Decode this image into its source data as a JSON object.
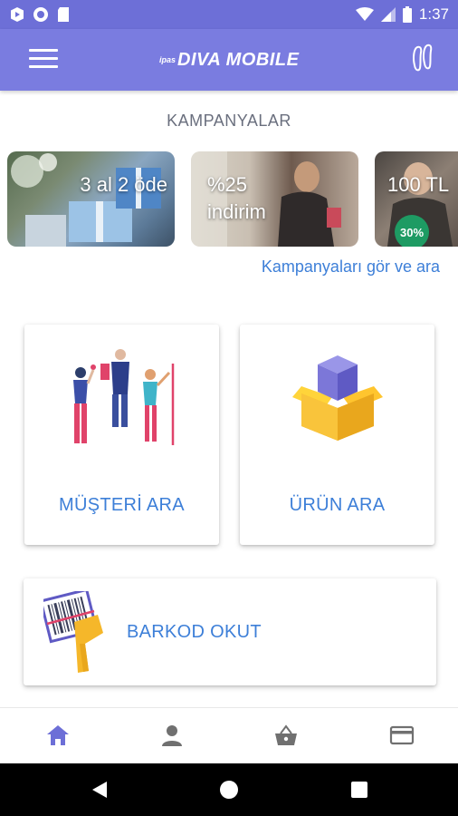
{
  "status_bar": {
    "time": "1:37"
  },
  "app_bar": {
    "logo_prefix": "ipas",
    "logo_text": "DIVA MOBILE"
  },
  "campaigns": {
    "title": "KAMPANYALAR",
    "items": [
      {
        "label": "3 al 2 öde"
      },
      {
        "label": "%25 indirim"
      },
      {
        "label": "100 TL",
        "badge": "30%"
      }
    ],
    "see_all_link": "Kampanyaları gör ve ara"
  },
  "actions": {
    "customer_search": "MÜŞTERİ ARA",
    "product_search": "ÜRÜN ARA",
    "barcode_scan": "BARKOD OKUT"
  },
  "bottom_nav": {
    "active_color": "#6d6fd7",
    "inactive_color": "#707070",
    "items": [
      "home-icon",
      "user-icon",
      "basket-icon",
      "card-icon"
    ]
  },
  "colors": {
    "primary": "#7a7ce0",
    "link": "#3d7fd8"
  }
}
